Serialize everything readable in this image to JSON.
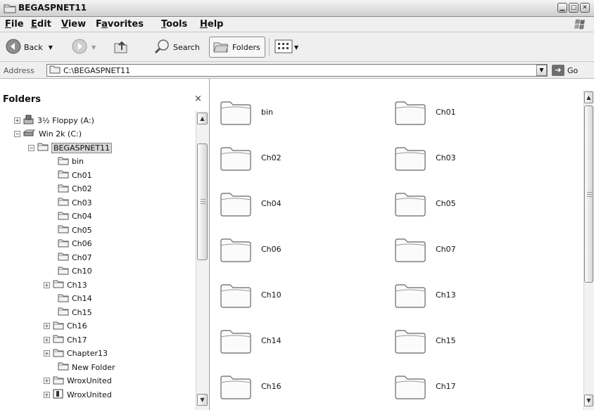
{
  "window": {
    "title": "BEGASPNET11"
  },
  "menu": [
    {
      "label": "File",
      "accel": "F",
      "rest": "ile"
    },
    {
      "label": "Edit",
      "accel": "E",
      "rest": "dit"
    },
    {
      "label": "View",
      "accel": "V",
      "rest": "iew"
    },
    {
      "label": "Favorites",
      "accel": "a",
      "pre": "F",
      "rest": "vorites"
    },
    {
      "label": "Tools",
      "accel": "T",
      "rest": "ools"
    },
    {
      "label": "Help",
      "accel": "H",
      "rest": "elp"
    }
  ],
  "toolbar": {
    "back": "Back",
    "search": "Search",
    "folders": "Folders"
  },
  "address": {
    "label": "Address",
    "value": "C:\\BEGASPNET11",
    "go": "Go"
  },
  "folders_pane": {
    "title": "Folders",
    "close": "×",
    "tree": [
      {
        "label": "3½ Floppy (A:)",
        "expander": "+",
        "icon": "floppy-icon"
      },
      {
        "label": "Win 2k (C:)",
        "expander": "−",
        "icon": "drive-icon"
      },
      {
        "label": "BEGASPNET11",
        "expander": "−",
        "icon": "folder-icon",
        "selected": true
      },
      {
        "label": "bin",
        "icon": "folder-icon"
      },
      {
        "label": "Ch01",
        "icon": "folder-icon"
      },
      {
        "label": "Ch02",
        "icon": "folder-icon"
      },
      {
        "label": "Ch03",
        "icon": "folder-icon"
      },
      {
        "label": "Ch04",
        "icon": "folder-icon"
      },
      {
        "label": "Ch05",
        "icon": "folder-icon"
      },
      {
        "label": "Ch06",
        "icon": "folder-icon"
      },
      {
        "label": "Ch07",
        "icon": "folder-icon"
      },
      {
        "label": "Ch10",
        "icon": "folder-icon"
      },
      {
        "label": "Ch13",
        "expander": "+",
        "icon": "folder-icon"
      },
      {
        "label": "Ch14",
        "icon": "folder-icon"
      },
      {
        "label": "Ch15",
        "icon": "folder-icon"
      },
      {
        "label": "Ch16",
        "expander": "+",
        "icon": "folder-icon"
      },
      {
        "label": "Ch17",
        "expander": "+",
        "icon": "folder-icon"
      },
      {
        "label": "Chapter13",
        "expander": "+",
        "icon": "folder-icon"
      },
      {
        "label": "New Folder",
        "icon": "folder-icon"
      },
      {
        "label": "WroxUnited",
        "expander": "+",
        "icon": "folder-icon"
      },
      {
        "label": "WroxUnited",
        "expander": "+",
        "icon": "web-folder-icon"
      }
    ]
  },
  "content": {
    "items": [
      "bin",
      "Ch01",
      "Ch02",
      "Ch03",
      "Ch04",
      "Ch05",
      "Ch06",
      "Ch07",
      "Ch10",
      "Ch13",
      "Ch14",
      "Ch15",
      "Ch16",
      "Ch17"
    ]
  }
}
